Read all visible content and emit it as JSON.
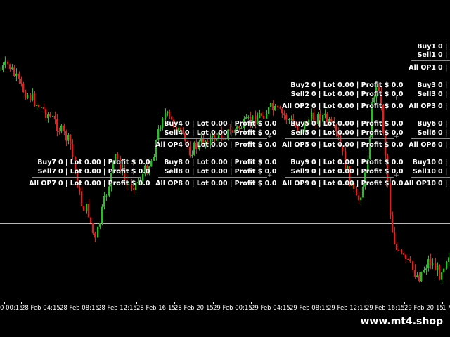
{
  "watermark": "www.mt4.shop",
  "colors": {
    "background": "#000000",
    "bull": "#25c025",
    "bear": "#e01f1f",
    "text": "#ffffff",
    "line": "#b8b8b8"
  },
  "time_axis": [
    "0 00:15",
    "28 Feb 04:15",
    "28 Feb 08:15",
    "28 Feb 12:15",
    "28 Feb 16:15",
    "28 Feb 20:15",
    "29 Feb 00:15",
    "29 Feb 04:15",
    "29 Feb 08:15",
    "29 Feb 12:15",
    "29 Feb 16:15",
    "29 Feb 20:15",
    "1 M"
  ],
  "panels": [
    {
      "id": "A",
      "rows": [
        {
          "label": "Buy4",
          "value": "0 | Lot 0.00 | Profit $ 0.0"
        },
        {
          "label": "Sell4",
          "value": "0 | Lot 0.00 | Profit $ 0.0"
        },
        {
          "label": "All OP4",
          "value": "0 | Lot 0.00 | Profit $ 0.0"
        }
      ]
    },
    {
      "id": "B",
      "rows": [
        {
          "label": "Buy7",
          "value": "0 | Lot 0.00 | Profit $ 0.0"
        },
        {
          "label": "Sell7",
          "value": "0 | Lot 0.00 | Profit $ 0.0"
        },
        {
          "label": "All OP7",
          "value": "0 | Lot 0.00 | Profit $ 0.0"
        }
      ]
    },
    {
      "id": "C",
      "rows": [
        {
          "label": "Buy8",
          "value": "0 | Lot 0.00 | Profit $ 0.0"
        },
        {
          "label": "Sell8",
          "value": "0 | Lot 0.00 | Profit $ 0.0"
        },
        {
          "label": "All OP8",
          "value": "0 | Lot 0.00 | Profit $ 0.0"
        }
      ]
    },
    {
      "id": "D",
      "rows": [
        {
          "label": "Buy2",
          "value": "0 | Lot 0.00 | Profit $ 0.0"
        },
        {
          "label": "Sell2",
          "value": "0 | Lot 0.00 | Profit $ 0.0"
        },
        {
          "label": "All OP2",
          "value": "0 | Lot 0.00 | Profit $ 0.0"
        }
      ]
    },
    {
      "id": "E",
      "rows": [
        {
          "label": "Buy5",
          "value": "0 | Lot 0.00 | Profit $ 0.0"
        },
        {
          "label": "Sell5",
          "value": "0 | Lot 0.00 | Profit $ 0.0"
        },
        {
          "label": "All OP5",
          "value": "0 | Lot 0.00 | Profit $ 0.0"
        }
      ]
    },
    {
      "id": "F",
      "rows": [
        {
          "label": "Buy9",
          "value": "0 | Lot 0.00 | Profit $ 0.0"
        },
        {
          "label": "Sell9",
          "value": "0 | Lot 0.00 | Profit $ 0.0"
        },
        {
          "label": "All OP9",
          "value": "0 | Lot 0.00 | Profit $ 0.0"
        }
      ]
    },
    {
      "id": "G",
      "rows": [
        {
          "label": "Buy1",
          "value": "0 |"
        },
        {
          "label": "Sell1",
          "value": "0 |"
        },
        {
          "label": "All OP1",
          "value": "0 |"
        }
      ]
    },
    {
      "id": "H",
      "rows": [
        {
          "label": "Buy3",
          "value": "0 |"
        },
        {
          "label": "Sell3",
          "value": "0 |"
        },
        {
          "label": "All OP3",
          "value": "0 |"
        }
      ]
    },
    {
      "id": "I",
      "rows": [
        {
          "label": "Buy6",
          "value": "0 |"
        },
        {
          "label": "Sell6",
          "value": "0 |"
        },
        {
          "label": "All OP6",
          "value": "0 |"
        }
      ]
    },
    {
      "id": "J",
      "rows": [
        {
          "label": "Buy10",
          "value": "0 |"
        },
        {
          "label": "Sell10",
          "value": "0 |"
        },
        {
          "label": "All OP10",
          "value": "0 |"
        }
      ]
    }
  ]
}
